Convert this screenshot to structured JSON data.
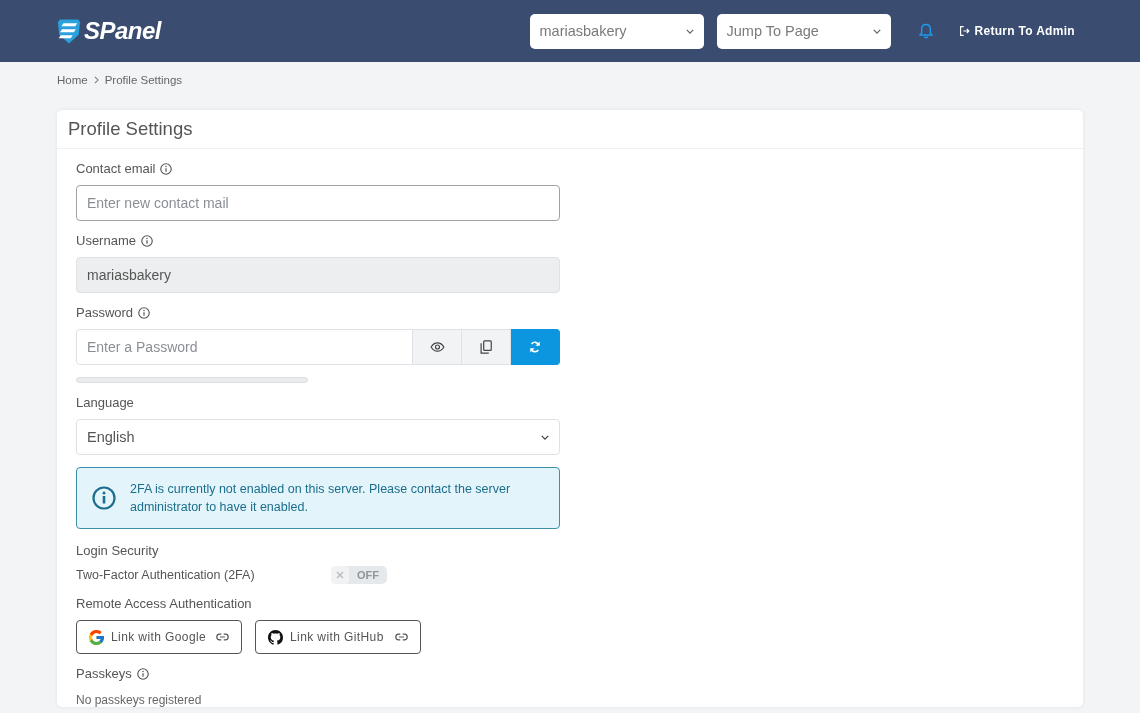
{
  "header": {
    "logo": "SPanel",
    "account_select": {
      "value": "mariasbakery"
    },
    "page_jump": {
      "value": "Jump To Page"
    },
    "return_link": "Return To Admin"
  },
  "breadcrumb": [
    {
      "label": "Home"
    },
    {
      "label": "Profile Settings"
    }
  ],
  "card": {
    "title": "Profile Settings",
    "fields": [
      {
        "kind": "text",
        "label": "Contact email",
        "info": true,
        "placeholder": "Enter new contact mail",
        "disabled": false
      },
      {
        "kind": "text",
        "label": "Username",
        "info": true,
        "value": "mariasbakery",
        "disabled": true
      },
      {
        "kind": "password",
        "label": "Password",
        "info": true,
        "placeholder": "Enter a Password",
        "disabled": false,
        "strength": {
          "level": 0
        }
      },
      {
        "kind": "select",
        "label": "Language",
        "info": false,
        "value": "English",
        "disabled": false
      }
    ],
    "alert": {
      "text": "2FA is currently not enabled on this server. Please contact the server administrator to have it enabled."
    },
    "login_security": {
      "heading": "Login Security",
      "two_factor": {
        "label": "Two-Factor Authentication (2FA)",
        "on": false,
        "disabled": true,
        "state_text": "OFF"
      }
    },
    "remote_access": {
      "heading": "Remote Access Authentication",
      "providers": [
        {
          "kind": "google",
          "label": "Link with Google"
        },
        {
          "kind": "github",
          "label": "Link with GitHub"
        }
      ]
    },
    "passkeys": {
      "heading": "Passkeys",
      "info": true,
      "empty_text": "No passkeys registered"
    }
  }
}
